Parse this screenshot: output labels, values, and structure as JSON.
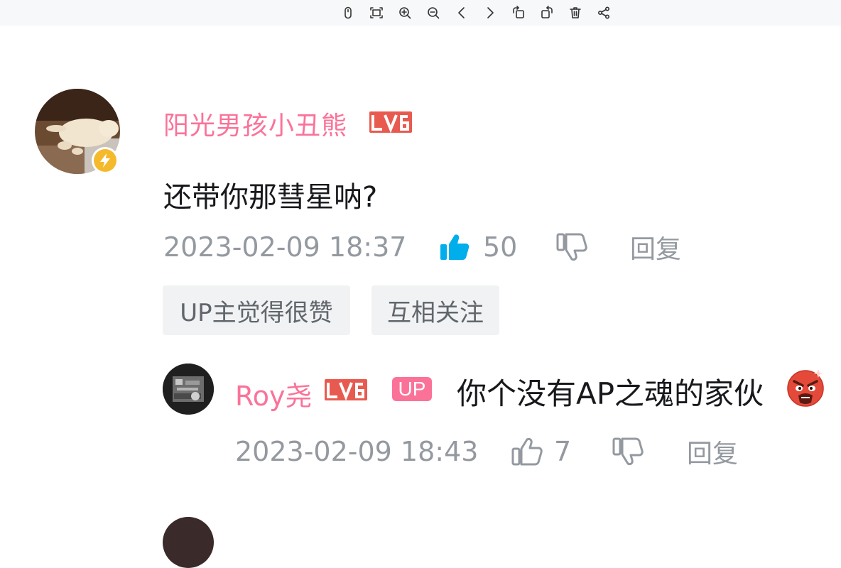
{
  "toolbar": {
    "icons": [
      "mouse-icon",
      "fit-screen-icon",
      "zoom-in-icon",
      "zoom-out-icon",
      "previous-icon",
      "next-icon",
      "rotate-left-icon",
      "rotate-right-icon",
      "delete-icon",
      "share-icon"
    ]
  },
  "comment": {
    "username": "阳光男孩小丑熊",
    "level": "LV6",
    "text": "还带你那彗星呐?",
    "timestamp": "2023-02-09 18:37",
    "likes": "50",
    "reply_label": "回复",
    "tags": [
      "UP主觉得很赞",
      "互相关注"
    ]
  },
  "reply": {
    "username": "Roy尧",
    "level": "LV6",
    "up_badge": "UP",
    "text": "你个没有AP之魂的家伙",
    "timestamp": "2023-02-09 18:43",
    "likes": "7",
    "reply_label": "回复"
  },
  "colors": {
    "username": "#fb7299",
    "level_badge": "#e85a4f",
    "like_active": "#00aeec",
    "meta_gray": "#9499a0"
  }
}
